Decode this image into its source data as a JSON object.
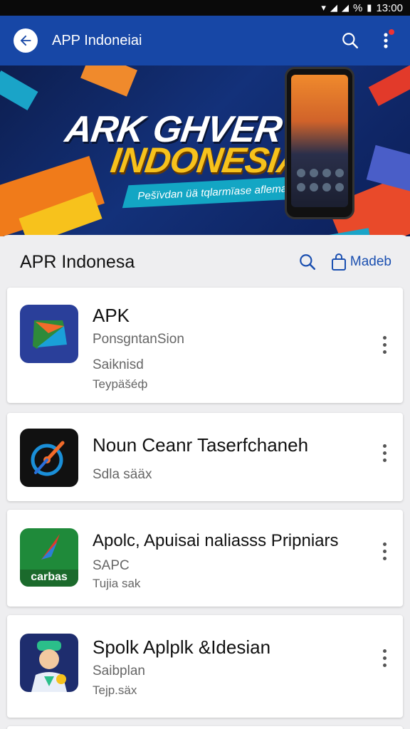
{
  "status_bar": {
    "time": "13:00",
    "battery": "%"
  },
  "app_bar": {
    "title": "APP Indoneiai"
  },
  "banner": {
    "title_line1": "ARK GHVER",
    "title_line2": "INDONESIA",
    "ribbon": "Pešïvdan üä tqlarmïase aflema"
  },
  "sheet": {
    "title": "APR Indonesa",
    "action_label": "Madeb"
  },
  "apps": [
    {
      "name": "APK",
      "subtitle": "PonsgntanSion",
      "line2": "Saiknisd",
      "line3": "Teypäšéф",
      "icon": "apk-icon"
    },
    {
      "name": "Noun Ceanr Taserfchaneh",
      "subtitle": "",
      "line2": "Sdla sääx",
      "line3": "",
      "icon": "compass-icon"
    },
    {
      "name": "Apolc, Apuisai naliasss Pripniars",
      "subtitle": "SAPC",
      "line2": "Tujia sak",
      "line3": "",
      "icon": "carbas-icon",
      "icon_label": "carbas"
    },
    {
      "name": "Spolk Aplplk &Idesian",
      "subtitle": "Saibplan",
      "line2": "Tejp.säx",
      "line3": "",
      "icon": "avatar-icon"
    }
  ],
  "colors": {
    "primary": "#1747a6",
    "accent": "#f7c21c",
    "link": "#1a4fb0"
  }
}
